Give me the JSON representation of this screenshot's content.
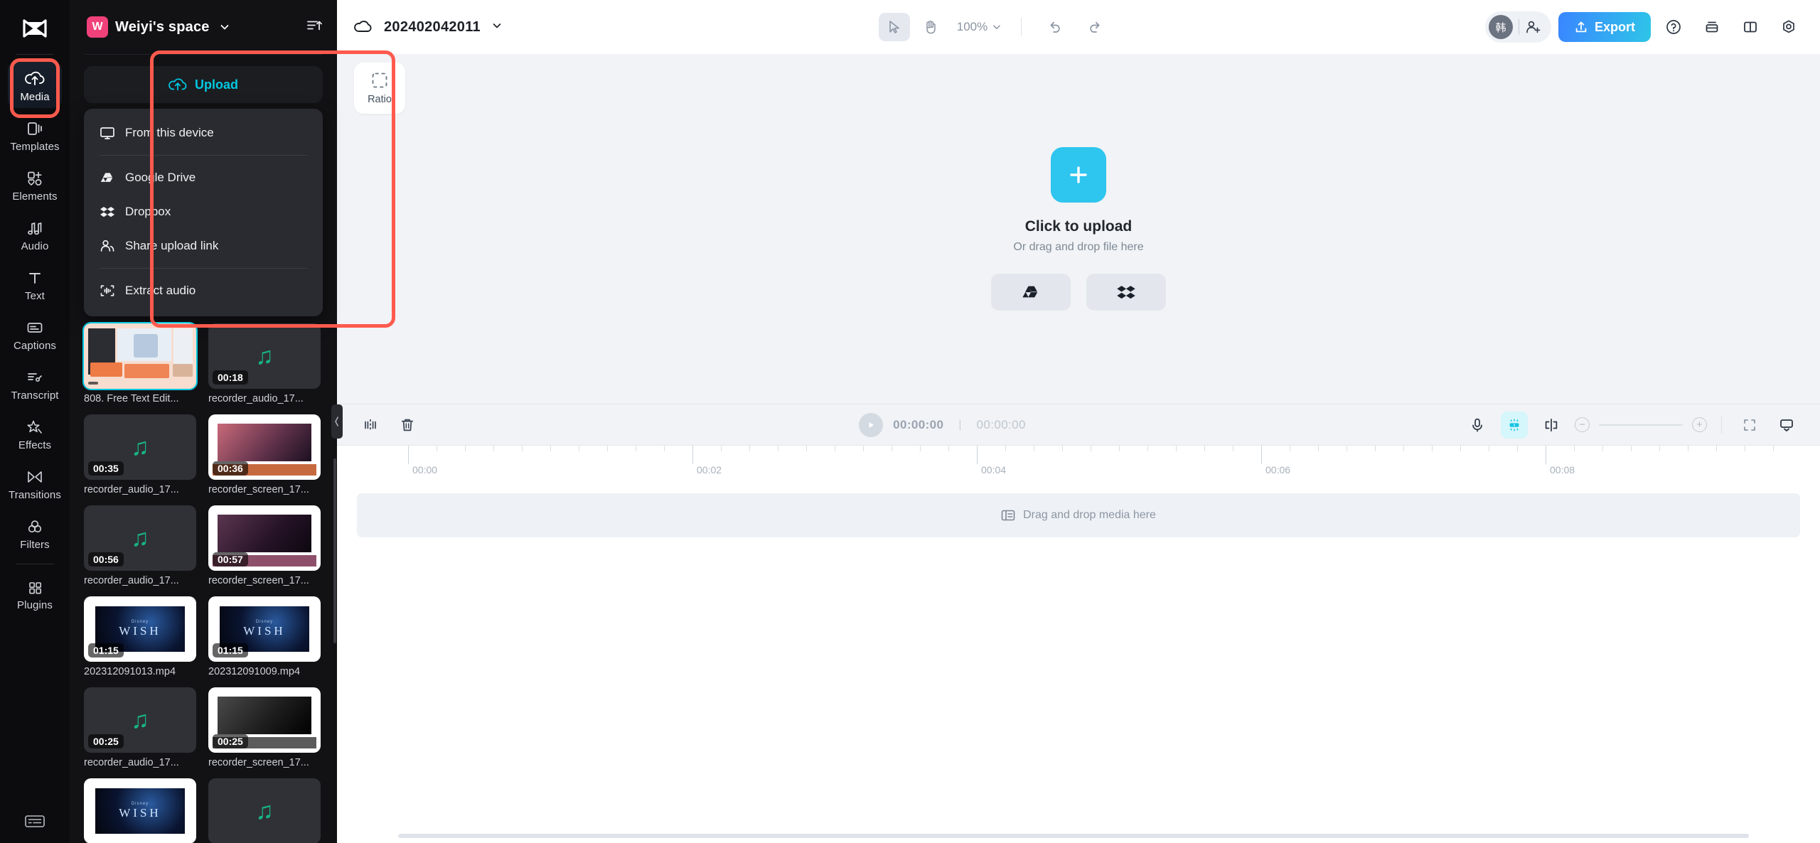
{
  "rail": {
    "logo_icon": "capcut-logo-icon",
    "items": [
      {
        "label": "Media",
        "icon": "cloud-upload-icon",
        "active": true
      },
      {
        "label": "Templates",
        "icon": "templates-icon",
        "active": false
      },
      {
        "label": "Elements",
        "icon": "elements-icon",
        "active": false
      },
      {
        "label": "Audio",
        "icon": "audio-note-icon",
        "active": false
      },
      {
        "label": "Text",
        "icon": "text-t-icon",
        "active": false
      },
      {
        "label": "Captions",
        "icon": "captions-icon",
        "active": false
      },
      {
        "label": "Transcript",
        "icon": "transcript-icon",
        "active": false
      },
      {
        "label": "Effects",
        "icon": "effects-sparkle-icon",
        "active": false
      },
      {
        "label": "Transitions",
        "icon": "transitions-icon",
        "active": false
      },
      {
        "label": "Filters",
        "icon": "filters-circles-icon",
        "active": false
      },
      {
        "label": "Plugins",
        "icon": "plugins-grid-icon",
        "active": false
      }
    ],
    "bottom_icon": "keyboard-icon",
    "highlight_color": "#ff5a4d"
  },
  "panel": {
    "workspace_initial": "W",
    "workspace_name": "Weiyi's space",
    "workspace_caret_icon": "chevron-down-icon",
    "sort_icon": "sort-ascending-icon",
    "upload": {
      "label": "Upload",
      "icon": "cloud-upload-icon",
      "accent": "#00c8e0"
    },
    "menu": [
      {
        "label": "From this device",
        "icon": "monitor-icon",
        "group": 0
      },
      {
        "label": "Google Drive",
        "icon": "google-drive-icon",
        "group": 1
      },
      {
        "label": "Dropbox",
        "icon": "dropbox-icon",
        "group": 1
      },
      {
        "label": "Share upload link",
        "icon": "people-icon",
        "group": 1
      },
      {
        "label": "Extract audio",
        "icon": "extract-audio-icon",
        "group": 2
      }
    ],
    "media": [
      {
        "name": "808. Free Text Edit...",
        "duration": "",
        "kind": "editor",
        "selected": true
      },
      {
        "name": "recorder_audio_17...",
        "duration": "00:18",
        "kind": "audio",
        "selected": false
      },
      {
        "name": "recorder_audio_17...",
        "duration": "00:35",
        "kind": "audio",
        "selected": false
      },
      {
        "name": "recorder_screen_17...",
        "duration": "00:36",
        "kind": "screen",
        "selected": false
      },
      {
        "name": "recorder_audio_17...",
        "duration": "00:56",
        "kind": "audio",
        "selected": false
      },
      {
        "name": "recorder_screen_17...",
        "duration": "00:57",
        "kind": "screen",
        "selected": false
      },
      {
        "name": "202312091013.mp4",
        "duration": "01:15",
        "kind": "wish",
        "selected": false
      },
      {
        "name": "202312091009.mp4",
        "duration": "01:15",
        "kind": "wish",
        "selected": false
      },
      {
        "name": "recorder_audio_17...",
        "duration": "00:25",
        "kind": "audio",
        "selected": false
      },
      {
        "name": "recorder_screen_17...",
        "duration": "00:25",
        "kind": "screen",
        "selected": false
      },
      {
        "name": "",
        "duration": "",
        "kind": "wish",
        "selected": false
      },
      {
        "name": "",
        "duration": "",
        "kind": "audio",
        "selected": false
      }
    ]
  },
  "topbar": {
    "cloud_icon": "cloud-icon",
    "project_name": "202402042011",
    "project_caret_icon": "chevron-down-icon",
    "select_tool_icon": "cursor-arrow-icon",
    "hand_tool_icon": "hand-icon",
    "zoom_level": "100%",
    "zoom_caret_icon": "chevron-down-icon",
    "undo_icon": "undo-icon",
    "redo_icon": "redo-icon",
    "avatar_initial": "韩",
    "add_user_icon": "add-user-icon",
    "export_label": "Export",
    "export_icon": "upload-share-icon",
    "help_icon": "question-circle-icon",
    "layers_icon": "layers-icon",
    "layout_icon": "panel-layout-icon",
    "settings_icon": "settings-gear-icon"
  },
  "stage": {
    "ratio_label": "Ratio",
    "ratio_icon": "ratio-dashed-square-icon",
    "plus_icon": "plus-icon",
    "upload_title": "Click to upload",
    "upload_sub": "Or drag and drop file here",
    "google_drive_icon": "google-drive-icon",
    "dropbox_icon": "dropbox-icon"
  },
  "timeline": {
    "split_icon": "split-clip-icon",
    "delete_icon": "trash-icon",
    "play_icon": "play-icon",
    "current_time": "00:00:00",
    "total_time": "00:00:00",
    "mic_icon": "microphone-icon",
    "auto_enhance_icon": "auto-adjust-icon",
    "keyframe_icon": "keyframe-icon",
    "zoom_out_icon": "minus-circle-icon",
    "zoom_in_icon": "plus-circle-icon",
    "fit_icon": "fit-to-screen-icon",
    "preview_icon": "preview-screen-icon",
    "ruler_labels": [
      "00:00",
      "00:02",
      "00:04",
      "00:06",
      "00:08"
    ],
    "drop_hint": "Drag and drop media here",
    "drop_hint_icon": "media-card-icon"
  }
}
